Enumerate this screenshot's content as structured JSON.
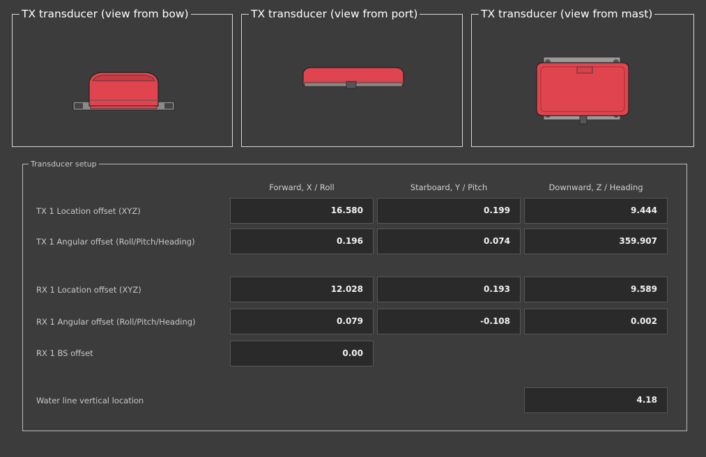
{
  "views": [
    {
      "title": "TX transducer (view from bow)"
    },
    {
      "title": "TX transducer (view from port)"
    },
    {
      "title": "TX transducer (view from mast)"
    }
  ],
  "setup": {
    "title": "Transducer setup",
    "columns": [
      "Forward, X / Roll",
      "Starboard, Y / Pitch",
      "Downward, Z / Heading"
    ],
    "rows": [
      {
        "label": "TX 1 Location offset (XYZ)",
        "values": [
          "16.580",
          "0.199",
          "9.444"
        ]
      },
      {
        "label": "TX 1 Angular offset (Roll/Pitch/Heading)",
        "values": [
          "0.196",
          "0.074",
          "359.907"
        ]
      },
      {
        "label": "RX 1 Location offset (XYZ)",
        "values": [
          "12.028",
          "0.193",
          "9.589"
        ]
      },
      {
        "label": "RX 1 Angular offset (Roll/Pitch/Heading)",
        "values": [
          "0.079",
          "-0.108",
          "0.002"
        ]
      },
      {
        "label": "RX 1 BS offset",
        "values": [
          "0.00"
        ]
      }
    ],
    "waterline": {
      "label": "Water line vertical location",
      "value": "4.18"
    }
  },
  "colors": {
    "transducer": "#e0454f",
    "background": "#3c3c3c"
  }
}
